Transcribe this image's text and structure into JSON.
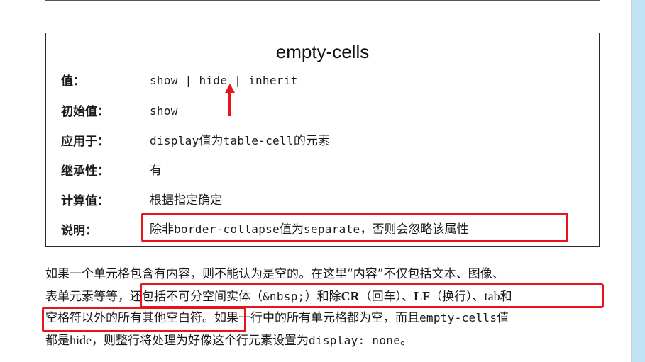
{
  "property": {
    "title": "empty-cells",
    "rows": [
      {
        "label": "值：",
        "value_parts": [
          "show | hide | inherit"
        ]
      },
      {
        "label": "初始值：",
        "value_parts": [
          "show"
        ]
      },
      {
        "label": "应用于：",
        "value_parts": [
          "display",
          "值为",
          "table-cell",
          "的元素"
        ]
      },
      {
        "label": "继承性：",
        "value_parts": [
          "有"
        ]
      },
      {
        "label": "计算值：",
        "value_parts": [
          "根据指定确定"
        ]
      },
      {
        "label": "说明：",
        "value_parts": [
          "除非",
          "border-collapse",
          "值为",
          "separate",
          "，否则会忽略该属性"
        ]
      }
    ]
  },
  "paragraph": {
    "line1": "如果一个单元格包含有内容，则不能认为是空的。在这里“内容”不仅包括文本、图像、",
    "line2_parts": [
      "表单元素等等，还包括不可分空间实体（",
      "&nbsp;",
      "）和除",
      "CR",
      "（回车）、",
      "LF",
      "（换行）、",
      "tab",
      "和"
    ],
    "line3_parts": [
      "空格符以外的所有其他空白符。",
      "如果一行中的所有单元格都为空，而且",
      "empty-cells",
      "值"
    ],
    "line4_parts": [
      "都是",
      "hide",
      "，则整行将处理为好像这个行元素设置为",
      "display: none",
      "。"
    ]
  },
  "colors": {
    "highlight": "#e8141b",
    "side_strip": "#bfe3f4"
  }
}
